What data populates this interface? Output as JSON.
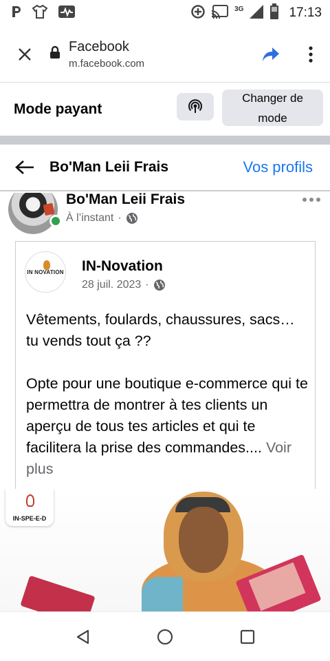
{
  "status_bar": {
    "network": "3G",
    "time": "17:13",
    "icons": [
      "parking-icon",
      "tshirt-icon",
      "activity-icon",
      "data-saver-icon",
      "cast-icon",
      "signal-icon",
      "battery-icon"
    ]
  },
  "browser": {
    "page_title": "Facebook",
    "domain": "m.facebook.com",
    "icons": [
      "close-icon",
      "lock-icon",
      "share-icon",
      "more-vert-icon"
    ]
  },
  "mode_bar": {
    "title": "Mode payant",
    "change_label": "Changer de mode"
  },
  "header": {
    "title": "Bo'Man Leii Frais",
    "profiles_link": "Vos profils"
  },
  "post": {
    "author": "Bo'Man Leii Frais",
    "time": "À l’instant",
    "separator": "·",
    "shared": {
      "page_name": "IN-Novation",
      "page_logo": "IN NOVATION",
      "date": "28 juil. 2023",
      "separator": "·",
      "paragraph1": "Vêtements, foulards, chaussures, sacs… tu vends tout ça ??",
      "paragraph2": "Opte pour une boutique e-commerce qui te permettra de montrer à tes clients un aperçu de tous tes articles et qui te facilitera la prise des commandes....",
      "see_more": "Voir plus"
    },
    "image": {
      "brand": "IN-SPE-E-D"
    }
  },
  "colors": {
    "link": "#1877f2",
    "online": "#31a24c",
    "secondary_text": "#65676b",
    "button_bg": "#e4e6eb"
  }
}
